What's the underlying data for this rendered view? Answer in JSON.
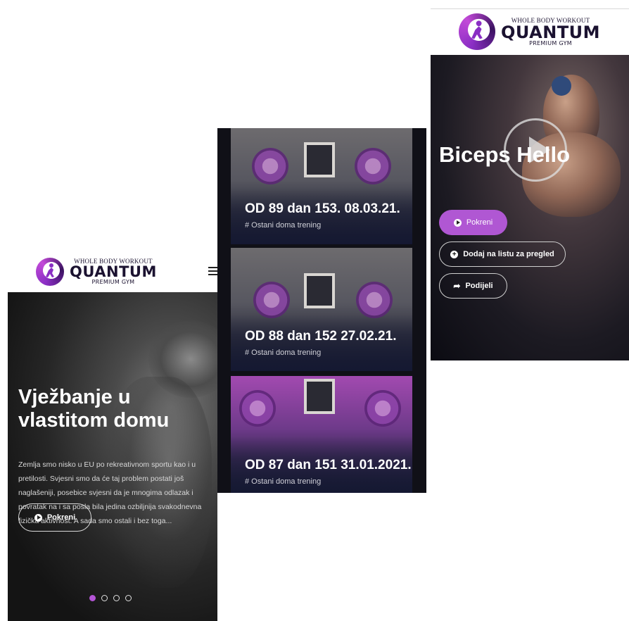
{
  "brand": {
    "top": "WHOLE BODY WORKOUT",
    "main": "QUANTUM",
    "bottom": "PREMIUM GYM",
    "accent": "#b057d3"
  },
  "panel1": {
    "title": "Vježbanje u vlastitom domu",
    "description": "Zemlja smo nisko u EU po rekreativnom sportu kao i u pretilosti. Svjesni smo da će taj problem postati još naglašeniji, posebice svjesni da je mnogima odlazak i povratak na i sa posla bila jedina ozbiljnija svakodnevna fizička aktivnost. A sada smo ostali i bez toga...",
    "button_label": "Pokreni",
    "menu_icon": "hamburger-icon",
    "slides_total": 4,
    "slide_active": 1
  },
  "panel2": {
    "cards": [
      {
        "title": "OD 89 dan 153. 08.03.21.",
        "tag": "# Ostani doma trening"
      },
      {
        "title": "OD 88 dan 152 27.02.21.",
        "tag": "# Ostani doma trening"
      },
      {
        "title": "OD 87 dan 151 31.01.2021.",
        "tag": "# Ostani doma trening"
      }
    ]
  },
  "panel3": {
    "title": "Biceps Hello",
    "play_button_label": "Pokreni",
    "watchlist_label": "Dodaj na listu za pregled",
    "share_label": "Podijeli"
  }
}
